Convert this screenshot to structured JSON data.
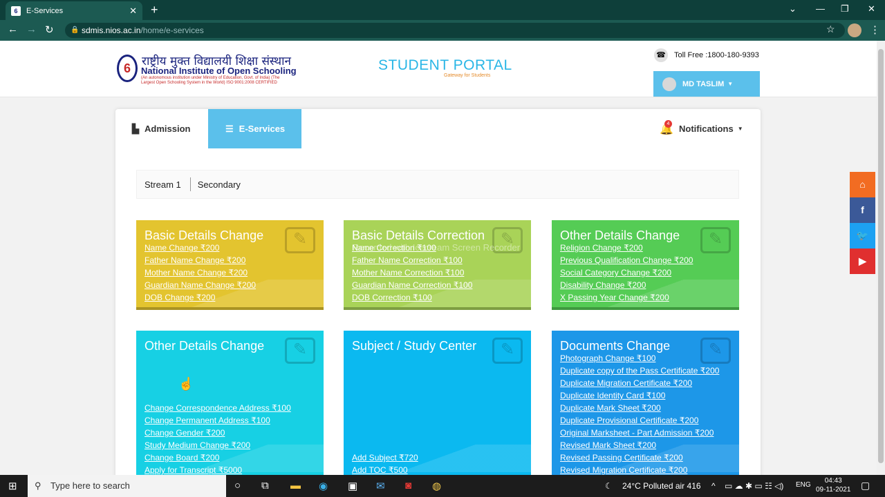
{
  "browser": {
    "tab_title": "E-Services",
    "url_host": "sdmis.nios.ac.in",
    "url_path": "/home/e-services"
  },
  "header": {
    "logo_hindi": "राष्ट्रीय मुक्त विद्यालयी शिक्षा संस्थान",
    "logo_english": "National Institute of Open Schooling",
    "logo_sub": "(An autonomous institution under Ministry of Education, Govt. of India) (The Largest Open Schooling System in the World) ISO 9001:2008 CERTIFIED",
    "portal_title": "STUDENT PORTAL",
    "portal_sub": "Gateway for Students",
    "toll_free": "Toll Free :1800-180-9393",
    "user_name": "MD TASLIM"
  },
  "menu": {
    "admission": "Admission",
    "eservices": "E-Services",
    "notifications": "Notifications",
    "notif_count": "4"
  },
  "stream": {
    "label": "Stream 1",
    "level": "Secondary"
  },
  "watermark": "Recorded with Icecream Screen Recorder",
  "boxes": [
    {
      "title": "Basic Details Change",
      "color": "#e3c42f",
      "links": [
        "Name Change ₹200",
        "Father Name Change ₹200",
        "Mother Name Change ₹200",
        "Guardian Name Change ₹200",
        "DOB Change ₹200"
      ]
    },
    {
      "title": "Basic Details Correction",
      "color": "#a9d358",
      "links": [
        "Name Correction ₹100",
        "Father Name Correction ₹100",
        "Mother Name Correction ₹100",
        "Guardian Name Correction ₹100",
        "DOB Correction ₹100"
      ]
    },
    {
      "title": "Other Details Change",
      "color": "#55cc55",
      "links": [
        "Religion Change ₹200",
        "Previous Qualification Change ₹200",
        "Social Category Change ₹200",
        "Disability Change ₹200",
        "X Passing Year Change ₹200"
      ]
    },
    {
      "title": "Other Details Change",
      "color": "#17d0e4",
      "links": [
        "Change Correspondence Address ₹100",
        "Change Permanent Address ₹100",
        "Change Gender ₹200",
        "Study Medium Change ₹200",
        "Change Board ₹200",
        "Apply for Transcript ₹5000"
      ]
    },
    {
      "title": "Subject / Study Center",
      "color": "#0bb9f0",
      "links": [
        "Add Subject ₹720",
        "Add TOC ₹500"
      ]
    },
    {
      "title": "Documents Change",
      "color": "#1d97e8",
      "links": [
        "Photograph Change ₹100",
        "Duplicate copy of the Pass Certificate ₹200",
        "Duplicate Migration Certificate ₹200",
        "Duplicate Identity Card ₹100",
        "Duplicate Mark Sheet ₹200",
        "Duplicate Provisional Certificate ₹200",
        "Original Marksheet - Part Admission ₹200",
        "Revised Mark Sheet ₹200",
        "Revised Passing Certificate ₹200",
        "Revised Migration Certificate ₹200"
      ]
    }
  ],
  "social": {
    "colors": [
      "#f26c22",
      "#3b5998",
      "#1da1f2",
      "#e02f2f"
    ]
  },
  "taskbar": {
    "search_placeholder": "Type here to search",
    "weather": "24°C  Polluted air 416",
    "lang": "ENG",
    "time": "04:43",
    "date": "09-11-2021"
  }
}
